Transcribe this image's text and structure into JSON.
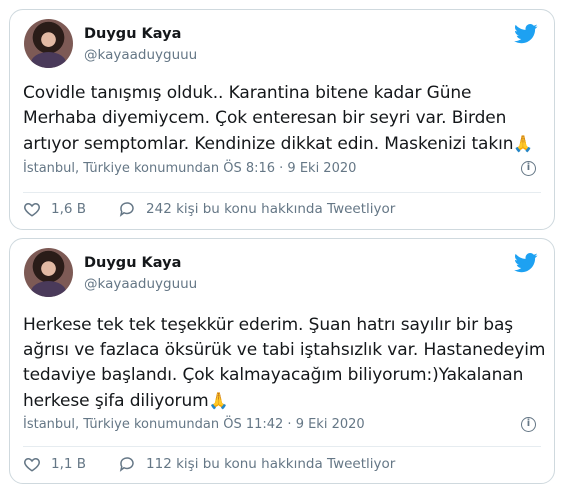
{
  "colors": {
    "accent": "#1da1f2",
    "muted": "#657786",
    "text": "#14171a",
    "border": "#cfd9de"
  },
  "tweets": [
    {
      "author_name": "Duygu Kaya",
      "author_handle": "@kayaaduyguuu",
      "text": "Covidle tanışmış olduk.. Karantina bitene kadar Güne\nMerhaba diyemiycem. Çok enteresan bir seyri var. Birden\nartıyor semptomlar. Kendinize dikkat edin. Maskenizi takın",
      "emoji": "🙏",
      "meta": "İstanbul, Türkiye konumundan ÖS 8:16 · 9 Eki 2020",
      "like_count": "1,6 B",
      "reply_text": "242 kişi bu konu hakkında Tweetliyor",
      "icons": [
        "twitter-bird-icon",
        "info-icon",
        "heart-icon",
        "speech-bubble-icon"
      ]
    },
    {
      "author_name": "Duygu Kaya",
      "author_handle": "@kayaaduyguuu",
      "text": "Herkese tek tek teşekkür ederim. Şuan hatrı sayılır bir baş\nağrısı ve fazlaca öksürük ve tabi iştahsızlık var. Hastanedeyim\ntedaviye başlandı. Çok kalmayacağım biliyorum:)Yakalanan\nherkese şifa diliyorum",
      "emoji": "🙏",
      "meta": "İstanbul, Türkiye konumundan ÖS 11:42 · 9 Eki 2020",
      "like_count": "1,1 B",
      "reply_text": "112 kişi bu konu hakkında Tweetliyor",
      "icons": [
        "twitter-bird-icon",
        "info-icon",
        "heart-icon",
        "speech-bubble-icon"
      ]
    }
  ]
}
